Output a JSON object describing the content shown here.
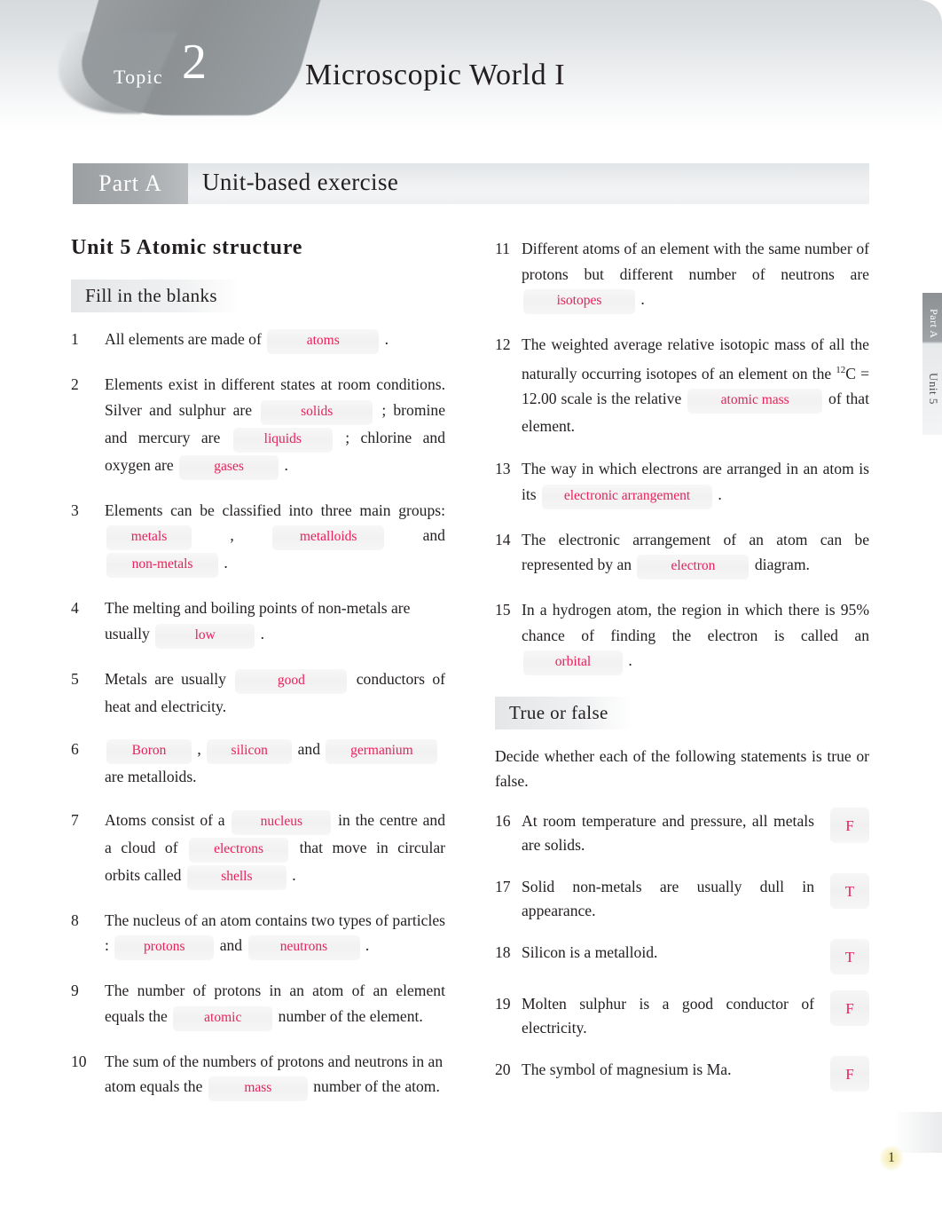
{
  "header": {
    "topic_word": "Topic",
    "topic_number": "2",
    "title": "Microscopic World I"
  },
  "part_band": {
    "chip": "Part A",
    "label": "Unit-based exercise"
  },
  "side_tab": {
    "part": "Part A",
    "unit": "Unit 5"
  },
  "unit_title": "Unit 5 Atomic structure",
  "sections": {
    "fill_blanks_heading": "Fill in the blanks",
    "true_false_heading": "True or false",
    "true_false_intro": "Decide whether each of the following statements is true or false."
  },
  "fill_in_the_blanks": [
    {
      "num": "1",
      "parts": [
        "All elements are made of "
      ],
      "answers": [
        "atoms"
      ],
      "tail": " ."
    },
    {
      "num": "2",
      "answers": [
        "solids",
        "liquids",
        "gases"
      ],
      "t1": "Elements exist in different states at room conditions. Silver and sulphur are ",
      "t2": " ; bromine and mercury are ",
      "t3": " ; chlorine and oxygen are ",
      "t4": " ."
    },
    {
      "num": "3",
      "answers": [
        "metals",
        "metalloids",
        "non-metals"
      ],
      "t1": "Elements can be classified into three main groups: ",
      "t2": " , ",
      "t3": " and ",
      "t4": " ."
    },
    {
      "num": "4",
      "answers": [
        "low"
      ],
      "t1": "The melting and boiling points of non-metals are usually ",
      "t2": " ."
    },
    {
      "num": "5",
      "answers": [
        "good"
      ],
      "t1": "Metals are usually ",
      "t2": " conductors of heat and electricity."
    },
    {
      "num": "6",
      "answers": [
        "Boron",
        "silicon",
        "germanium"
      ],
      "t1": "",
      "t2": " , ",
      "t3": " and ",
      "t4": " are metalloids."
    },
    {
      "num": "7",
      "answers": [
        "nucleus",
        "electrons",
        "shells"
      ],
      "t1": "Atoms consist of a ",
      "t2": " in the centre and a cloud of ",
      "t3": " that move in circular orbits called ",
      "t4": " ."
    },
    {
      "num": "8",
      "answers": [
        "protons",
        "neutrons"
      ],
      "t1": "The nucleus of an atom contains two types of particles : ",
      "t2": " and ",
      "t3": " ."
    },
    {
      "num": "9",
      "answers": [
        "atomic"
      ],
      "t1": "The number of protons in an atom of an element equals the ",
      "t2": " number of the element."
    },
    {
      "num": "10",
      "answers": [
        "mass"
      ],
      "t1": "The sum of the numbers of protons and neutrons in an atom equals the ",
      "t2": " number of the atom."
    },
    {
      "num": "11",
      "answers": [
        "isotopes"
      ],
      "t1": "Different atoms of an element with the same number of protons but different number of neutrons are ",
      "t2": " ."
    },
    {
      "num": "12",
      "answers": [
        "atomic mass"
      ],
      "t1": "The weighted average relative isotopic mass of all the naturally occurring isotopes of an element on the ",
      "sup": "12",
      "t2": "C = 12.00 scale is the relative ",
      "t3": " of that element."
    },
    {
      "num": "13",
      "answers": [
        "electronic arrangement"
      ],
      "t1": "The way in which electrons are arranged in an atom is its ",
      "t2": " ."
    },
    {
      "num": "14",
      "answers": [
        "electron"
      ],
      "t1": "The electronic arrangement of an atom can be represented by an ",
      "t2": " diagram."
    },
    {
      "num": "15",
      "answers": [
        "orbital"
      ],
      "t1": "In a hydrogen atom, the region in which there is 95% chance of finding the electron is called an ",
      "t2": " ."
    }
  ],
  "true_false": [
    {
      "num": "16",
      "text": "At room temperature and pressure, all metals are solids.",
      "answer": "F"
    },
    {
      "num": "17",
      "text": "Solid non-metals are usually dull in appearance.",
      "answer": "T"
    },
    {
      "num": "18",
      "text": "Silicon is a metalloid.",
      "answer": "T"
    },
    {
      "num": "19",
      "text": "Molten sulphur is a good conductor of electricity.",
      "answer": "F"
    },
    {
      "num": "20",
      "text": "The symbol of magnesium is Ma.",
      "answer": "F"
    }
  ],
  "page_number": "1",
  "colors": {
    "answer_pink": "#e8215c",
    "banner_gray": "#d7dadd",
    "chip_gray": "#9b9fa2",
    "text_dark": "#231f20"
  }
}
